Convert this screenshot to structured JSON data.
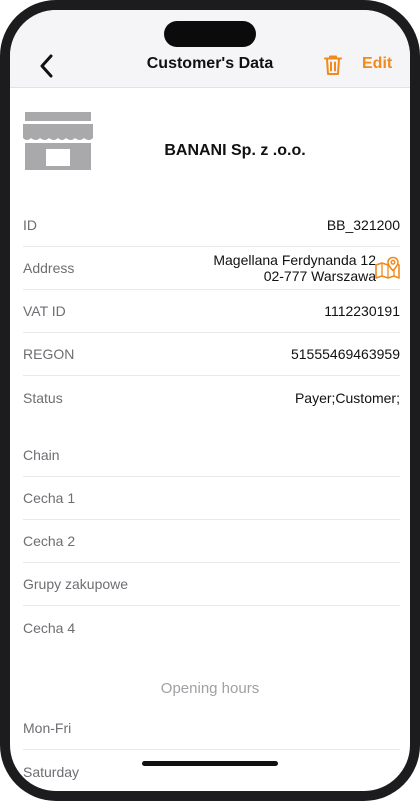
{
  "header": {
    "title": "Customer's Data",
    "edit_label": "Edit",
    "accent_color": "#f08a1c"
  },
  "icons": {
    "back": "chevron-left-icon",
    "delete": "trash-icon",
    "store": "store-icon",
    "map": "map-pin-icon"
  },
  "customer": {
    "name": "BANANI Sp. z .o.o.",
    "id_label": "ID",
    "id_value": "BB_321200",
    "address_label": "Address",
    "address_line1": "Magellana Ferdynanda 12",
    "address_line2": "02-777 Warszawa",
    "vat_label": "VAT ID",
    "vat_value": "1112230191",
    "regon_label": "REGON",
    "regon_value": "51555469463959",
    "status_label": "Status",
    "status_value": "Payer;Customer;"
  },
  "attributes": {
    "chain": "Chain",
    "cecha1": "Cecha 1",
    "cecha2": "Cecha 2",
    "grupy": "Grupy zakupowe",
    "cecha4": "Cecha 4"
  },
  "opening_hours": {
    "title": "Opening hours",
    "mon_fri": "Mon-Fri",
    "saturday": "Saturday"
  }
}
